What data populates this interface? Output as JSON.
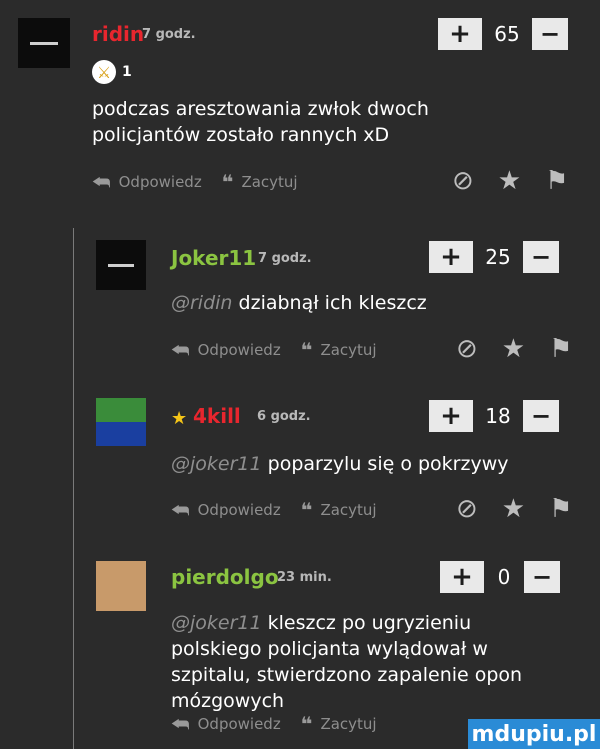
{
  "comments": [
    {
      "username": "ridin",
      "time": "7 godz.",
      "score": "65",
      "badge_count": "1",
      "text": "podczas aresztowania zwłok dwoch policjantów zostało rannych xD",
      "user_color": "#e8262e"
    },
    {
      "username": "Joker11",
      "time": "7 godz.",
      "score": "25",
      "mention": "@ridin",
      "text": "dziabnął ich kleszcz",
      "user_color": "#8bc441"
    },
    {
      "username": "4kill",
      "time": "6 godz.",
      "score": "18",
      "mention": "@joker11",
      "text": "poparzylu się o pokrzywy",
      "user_color": "#e8262e",
      "star": "★"
    },
    {
      "username": "pierdolgo",
      "time": "23 min.",
      "score": "0",
      "mention": "@joker11",
      "text": "kleszcz po ugryzieniu polskiego policjanta wylądował w szpitalu, stwierdzono zapalenie opon mózgowych",
      "user_color": "#8bc441"
    }
  ],
  "actions": {
    "reply_label": "Odpowiedz",
    "quote_label": "Zacytuj"
  },
  "vote": {
    "plus": "+",
    "minus": "−"
  },
  "icons": [
    "reply-arrow-icon",
    "quote-icon",
    "hide-icon",
    "star-icon",
    "flag-icon",
    "badge-icon",
    "plus-icon",
    "minus-icon"
  ],
  "watermark": "mdupiu.pl"
}
